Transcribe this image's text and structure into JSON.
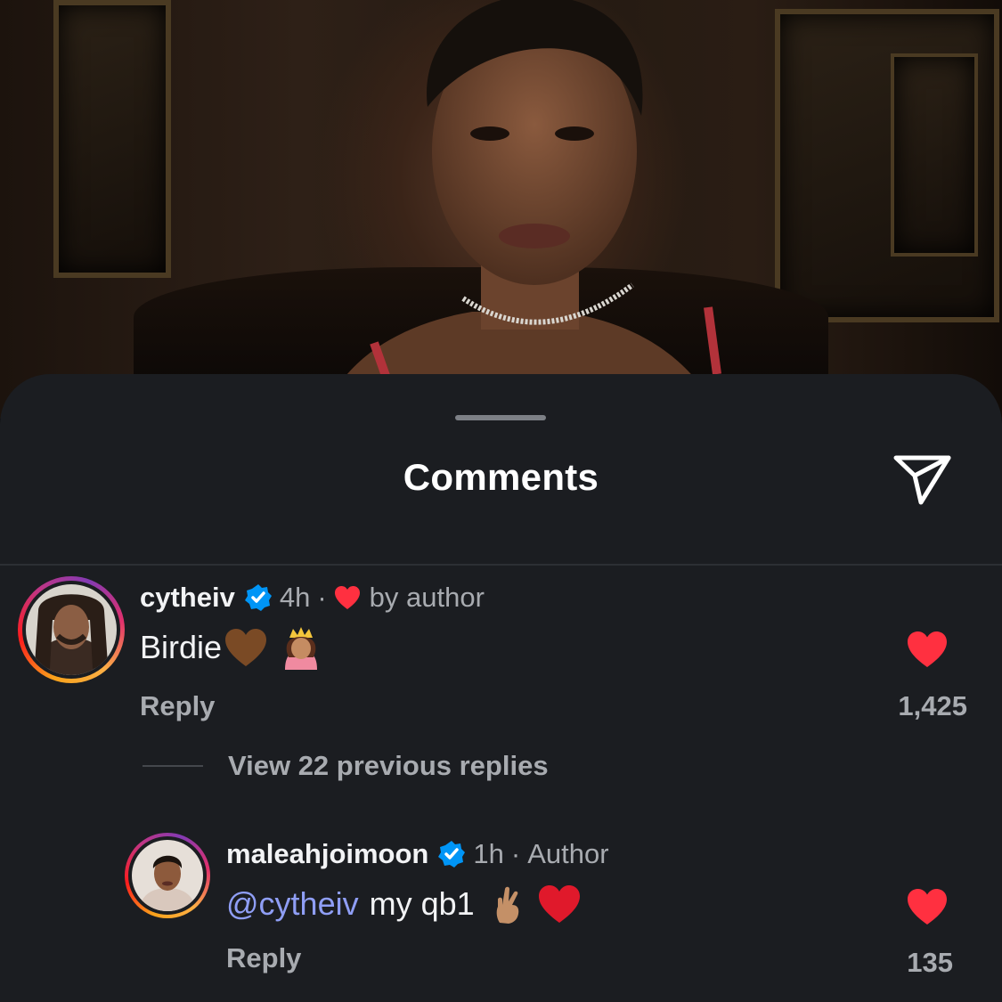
{
  "sheet": {
    "title": "Comments",
    "share_icon": "send-paper-plane-icon"
  },
  "comments": [
    {
      "username": "cytheiv",
      "verified": true,
      "time": "4h",
      "separator": "·",
      "liked_by_author_label": "by author",
      "text": "Birdie",
      "emojis": [
        "brown-heart-emoji",
        "princess-emoji"
      ],
      "reply_label": "Reply",
      "like_count": "1,425",
      "liked": true
    }
  ],
  "replies_toggle": {
    "label": "View 22 previous replies"
  },
  "replies": [
    {
      "username": "maleahjoimoon",
      "verified": true,
      "time": "1h",
      "separator": "·",
      "badge": "Author",
      "mention": "@cytheiv",
      "text": "my qb1",
      "emojis": [
        "crossed-fingers-emoji",
        "red-heart-emoji"
      ],
      "reply_label": "Reply",
      "like_count": "135",
      "liked": true
    }
  ],
  "colors": {
    "sheet_bg": "#1b1d21",
    "like_red": "#ff3040",
    "verified_blue": "#0095f6",
    "mention_blue": "#8f9ef5"
  }
}
